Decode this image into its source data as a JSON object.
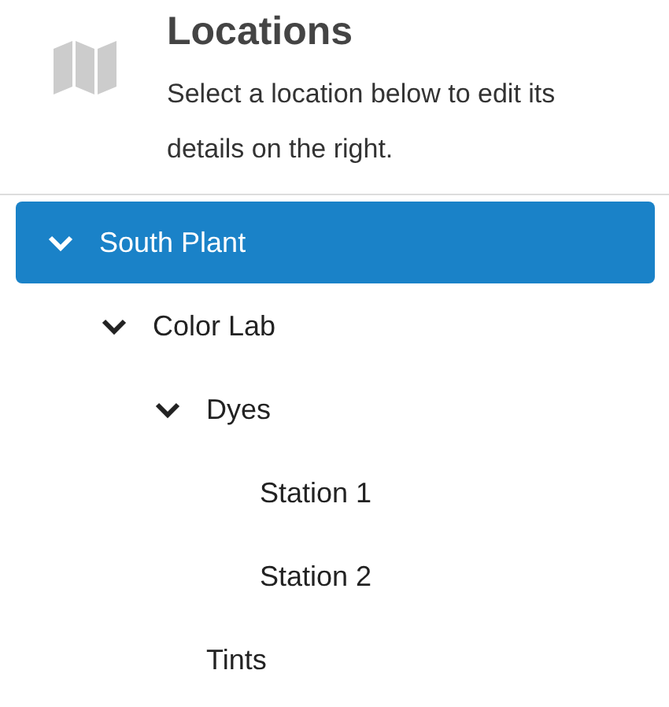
{
  "header": {
    "title": "Locations",
    "description": "Select a location below to edit its details on the right."
  },
  "tree": [
    {
      "label": "South Plant",
      "selected": true,
      "expanded": true,
      "children": [
        {
          "label": "Color Lab",
          "selected": false,
          "expanded": true,
          "children": [
            {
              "label": "Dyes",
              "selected": false,
              "expanded": true,
              "children": [
                {
                  "label": "Station 1",
                  "selected": false
                },
                {
                  "label": "Station 2",
                  "selected": false
                }
              ]
            },
            {
              "label": "Tints",
              "selected": false
            }
          ]
        }
      ]
    }
  ]
}
